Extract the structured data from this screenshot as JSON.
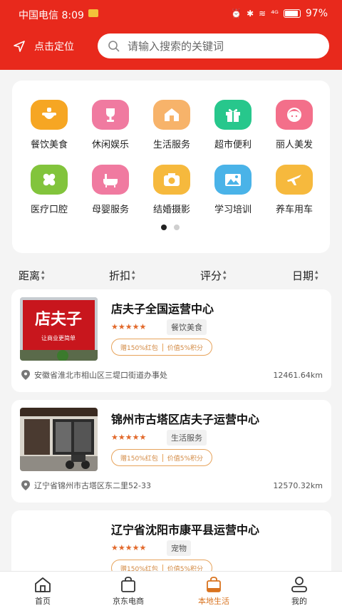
{
  "status_bar": {
    "carrier_time": "中国电信 8:09",
    "indicators": "⁴ᴳ",
    "battery": "97%"
  },
  "header": {
    "locate_label": "点击定位",
    "search_placeholder": "请输入搜索的关键词"
  },
  "categories": [
    {
      "label": "餐饮美食",
      "icon": "food-icon",
      "color": "#f6a623"
    },
    {
      "label": "休闲娱乐",
      "icon": "trophy-icon",
      "color": "#f07aa0"
    },
    {
      "label": "生活服务",
      "icon": "house-icon",
      "color": "#f7b36a"
    },
    {
      "label": "超市便利",
      "icon": "gift-icon",
      "color": "#27c78c"
    },
    {
      "label": "丽人美发",
      "icon": "beauty-icon",
      "color": "#f36f8a"
    },
    {
      "label": "医疗口腔",
      "icon": "bandage-icon",
      "color": "#82c43c"
    },
    {
      "label": "母婴服务",
      "icon": "bathtub-icon",
      "color": "#f07aa0"
    },
    {
      "label": "结婚摄影",
      "icon": "camera-icon",
      "color": "#f6b93d"
    },
    {
      "label": "学习培训",
      "icon": "picture-icon",
      "color": "#4ab3e8"
    },
    {
      "label": "养车用车",
      "icon": "plane-icon",
      "color": "#f6b93d"
    }
  ],
  "filters": [
    {
      "label": "距离"
    },
    {
      "label": "折扣"
    },
    {
      "label": "评分"
    },
    {
      "label": "日期"
    }
  ],
  "shops": [
    {
      "name": "店夫子全国运营中心",
      "stars": "★★★★★",
      "tag": "餐饮美食",
      "promo_left": "赠150%红包",
      "promo_right": "价值5%积分",
      "address": "安徽省淮北市相山区三堤口街道办事处",
      "distance": "12461.64km",
      "sign_text": "店夫子",
      "sign_sub": "让商业更简单"
    },
    {
      "name": "锦州市古塔区店夫子运营中心",
      "stars": "★★★★★",
      "tag": "生活服务",
      "promo_left": "赠150%红包",
      "promo_right": "价值5%积分",
      "address": "辽宁省锦州市古塔区东二里52-33",
      "distance": "12570.32km"
    },
    {
      "name": "辽宁省沈阳市康平县运营中心",
      "stars": "★★★★★",
      "tag": "宠物",
      "promo_left": "赠150%红包",
      "promo_right": "价值5%积分"
    }
  ],
  "bottom_nav": [
    {
      "label": "首页",
      "icon": "home-icon"
    },
    {
      "label": "京东电商",
      "icon": "shopping-bag-icon"
    },
    {
      "label": "本地生活",
      "icon": "local-bag-icon",
      "active": true
    },
    {
      "label": "我的",
      "icon": "user-icon"
    }
  ],
  "colors": {
    "brand": "#e8291c",
    "accent": "#d9731f",
    "star": "#e2692b"
  }
}
